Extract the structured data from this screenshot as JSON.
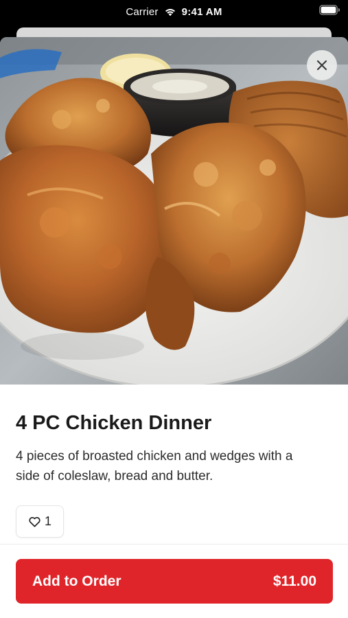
{
  "status_bar": {
    "carrier": "Carrier",
    "time": "9:41 AM",
    "wifi_icon": "wifi-icon",
    "battery_icon": "battery-icon"
  },
  "item": {
    "image_alt": "fried-chicken-photo",
    "title": "4 PC Chicken Dinner",
    "description": "4 pieces of broasted chicken and wedges with a side of coleslaw, bread and butter.",
    "like_count": "1"
  },
  "actions": {
    "close_icon": "close-icon",
    "heart_icon": "heart-icon",
    "add_label": "Add to Order",
    "price": "$11.00"
  },
  "colors": {
    "accent": "#e0252a",
    "text": "#1a1a1a"
  }
}
